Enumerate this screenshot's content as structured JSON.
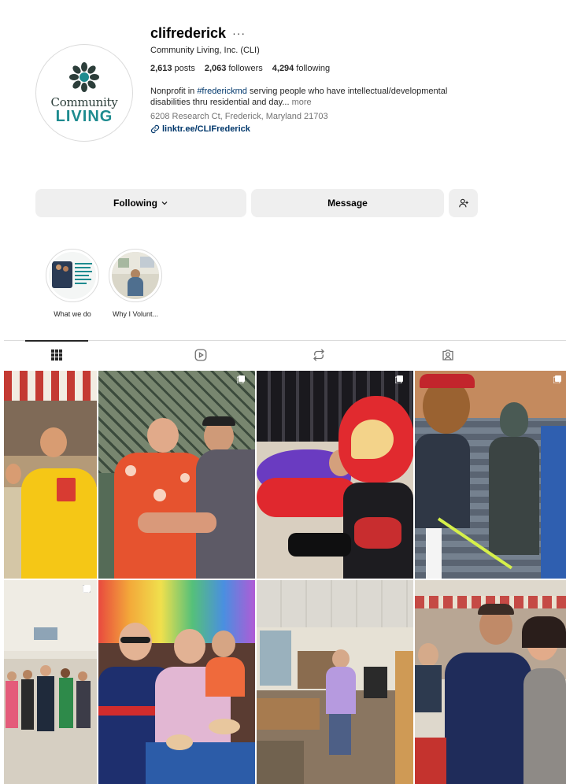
{
  "profile": {
    "username": "clifrederick",
    "more_icon": "more-horizontal-icon",
    "full_name": "Community Living, Inc. (CLI)",
    "avatar_logo": {
      "word1": "Community",
      "word2": "LIVING",
      "brand_color": "#1d8b8f"
    },
    "stats": {
      "posts_count": "2,613",
      "posts_label": "posts",
      "followers_count": "2,063",
      "followers_label": "followers",
      "following_count": "4,294",
      "following_label": "following"
    },
    "bio": {
      "prefix": "Nonprofit in ",
      "hashtag": "#frederickmd",
      "suffix": " serving people who have intellectual/developmental disabilities thru residential and day...",
      "more": " more"
    },
    "address": "6208 Research Ct, Frederick, Maryland 21703",
    "link": "linktr.ee/CLIFrederick"
  },
  "actions": {
    "following_label": "Following",
    "message_label": "Message"
  },
  "highlights": [
    {
      "label": "What we do"
    },
    {
      "label": "Why I Volunt..."
    }
  ],
  "tabs": [
    {
      "name": "posts",
      "icon": "grid-icon",
      "active": true
    },
    {
      "name": "reels",
      "icon": "reels-icon",
      "active": false
    },
    {
      "name": "reposts",
      "icon": "repost-icon",
      "active": false
    },
    {
      "name": "tagged",
      "icon": "tagged-icon",
      "active": false
    }
  ],
  "colors": {
    "button_bg": "#efefef",
    "link": "#00376b",
    "secondary_text": "#737373",
    "border": "#dbdbdb"
  }
}
